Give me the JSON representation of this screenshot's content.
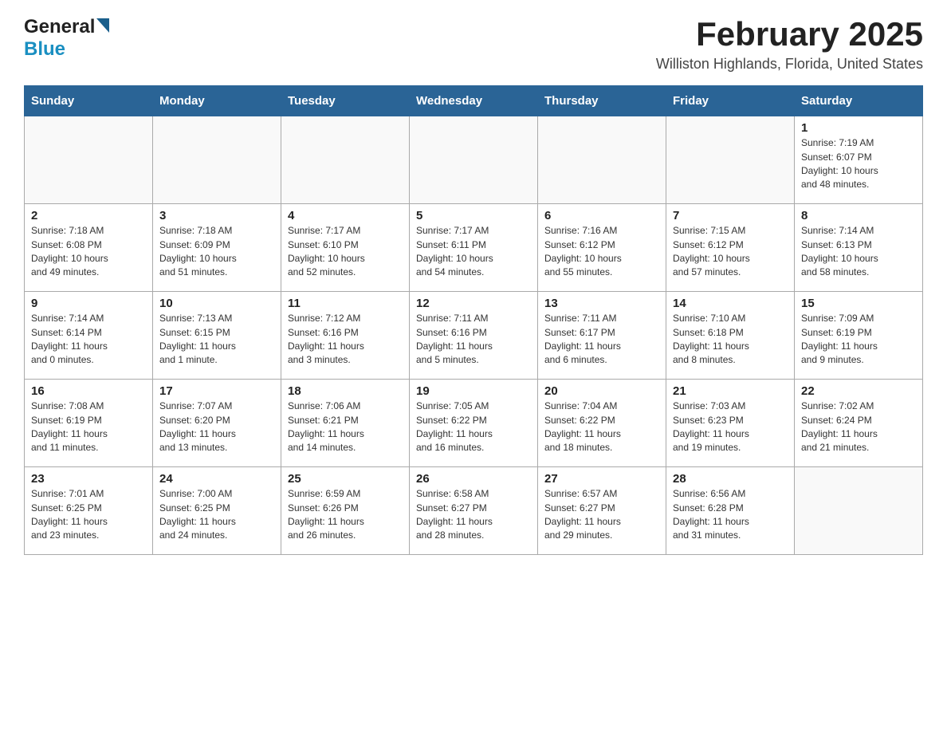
{
  "header": {
    "logo_general": "General",
    "logo_blue": "Blue",
    "month_title": "February 2025",
    "location": "Williston Highlands, Florida, United States"
  },
  "days_of_week": [
    "Sunday",
    "Monday",
    "Tuesday",
    "Wednesday",
    "Thursday",
    "Friday",
    "Saturday"
  ],
  "weeks": [
    [
      {
        "day": "",
        "info": ""
      },
      {
        "day": "",
        "info": ""
      },
      {
        "day": "",
        "info": ""
      },
      {
        "day": "",
        "info": ""
      },
      {
        "day": "",
        "info": ""
      },
      {
        "day": "",
        "info": ""
      },
      {
        "day": "1",
        "info": "Sunrise: 7:19 AM\nSunset: 6:07 PM\nDaylight: 10 hours\nand 48 minutes."
      }
    ],
    [
      {
        "day": "2",
        "info": "Sunrise: 7:18 AM\nSunset: 6:08 PM\nDaylight: 10 hours\nand 49 minutes."
      },
      {
        "day": "3",
        "info": "Sunrise: 7:18 AM\nSunset: 6:09 PM\nDaylight: 10 hours\nand 51 minutes."
      },
      {
        "day": "4",
        "info": "Sunrise: 7:17 AM\nSunset: 6:10 PM\nDaylight: 10 hours\nand 52 minutes."
      },
      {
        "day": "5",
        "info": "Sunrise: 7:17 AM\nSunset: 6:11 PM\nDaylight: 10 hours\nand 54 minutes."
      },
      {
        "day": "6",
        "info": "Sunrise: 7:16 AM\nSunset: 6:12 PM\nDaylight: 10 hours\nand 55 minutes."
      },
      {
        "day": "7",
        "info": "Sunrise: 7:15 AM\nSunset: 6:12 PM\nDaylight: 10 hours\nand 57 minutes."
      },
      {
        "day": "8",
        "info": "Sunrise: 7:14 AM\nSunset: 6:13 PM\nDaylight: 10 hours\nand 58 minutes."
      }
    ],
    [
      {
        "day": "9",
        "info": "Sunrise: 7:14 AM\nSunset: 6:14 PM\nDaylight: 11 hours\nand 0 minutes."
      },
      {
        "day": "10",
        "info": "Sunrise: 7:13 AM\nSunset: 6:15 PM\nDaylight: 11 hours\nand 1 minute."
      },
      {
        "day": "11",
        "info": "Sunrise: 7:12 AM\nSunset: 6:16 PM\nDaylight: 11 hours\nand 3 minutes."
      },
      {
        "day": "12",
        "info": "Sunrise: 7:11 AM\nSunset: 6:16 PM\nDaylight: 11 hours\nand 5 minutes."
      },
      {
        "day": "13",
        "info": "Sunrise: 7:11 AM\nSunset: 6:17 PM\nDaylight: 11 hours\nand 6 minutes."
      },
      {
        "day": "14",
        "info": "Sunrise: 7:10 AM\nSunset: 6:18 PM\nDaylight: 11 hours\nand 8 minutes."
      },
      {
        "day": "15",
        "info": "Sunrise: 7:09 AM\nSunset: 6:19 PM\nDaylight: 11 hours\nand 9 minutes."
      }
    ],
    [
      {
        "day": "16",
        "info": "Sunrise: 7:08 AM\nSunset: 6:19 PM\nDaylight: 11 hours\nand 11 minutes."
      },
      {
        "day": "17",
        "info": "Sunrise: 7:07 AM\nSunset: 6:20 PM\nDaylight: 11 hours\nand 13 minutes."
      },
      {
        "day": "18",
        "info": "Sunrise: 7:06 AM\nSunset: 6:21 PM\nDaylight: 11 hours\nand 14 minutes."
      },
      {
        "day": "19",
        "info": "Sunrise: 7:05 AM\nSunset: 6:22 PM\nDaylight: 11 hours\nand 16 minutes."
      },
      {
        "day": "20",
        "info": "Sunrise: 7:04 AM\nSunset: 6:22 PM\nDaylight: 11 hours\nand 18 minutes."
      },
      {
        "day": "21",
        "info": "Sunrise: 7:03 AM\nSunset: 6:23 PM\nDaylight: 11 hours\nand 19 minutes."
      },
      {
        "day": "22",
        "info": "Sunrise: 7:02 AM\nSunset: 6:24 PM\nDaylight: 11 hours\nand 21 minutes."
      }
    ],
    [
      {
        "day": "23",
        "info": "Sunrise: 7:01 AM\nSunset: 6:25 PM\nDaylight: 11 hours\nand 23 minutes."
      },
      {
        "day": "24",
        "info": "Sunrise: 7:00 AM\nSunset: 6:25 PM\nDaylight: 11 hours\nand 24 minutes."
      },
      {
        "day": "25",
        "info": "Sunrise: 6:59 AM\nSunset: 6:26 PM\nDaylight: 11 hours\nand 26 minutes."
      },
      {
        "day": "26",
        "info": "Sunrise: 6:58 AM\nSunset: 6:27 PM\nDaylight: 11 hours\nand 28 minutes."
      },
      {
        "day": "27",
        "info": "Sunrise: 6:57 AM\nSunset: 6:27 PM\nDaylight: 11 hours\nand 29 minutes."
      },
      {
        "day": "28",
        "info": "Sunrise: 6:56 AM\nSunset: 6:28 PM\nDaylight: 11 hours\nand 31 minutes."
      },
      {
        "day": "",
        "info": ""
      }
    ]
  ]
}
